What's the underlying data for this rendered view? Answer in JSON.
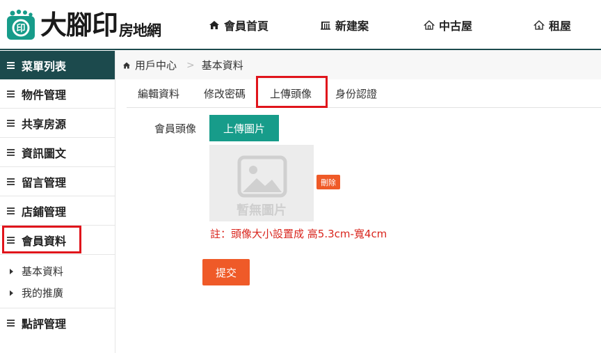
{
  "header": {
    "logo_text": "大腳印",
    "logo_sub": "房地網",
    "nav": [
      {
        "label": "會員首頁",
        "icon": "home-icon"
      },
      {
        "label": "新建案",
        "icon": "building-icon"
      },
      {
        "label": "中古屋",
        "icon": "house-icon"
      },
      {
        "label": "租屋",
        "icon": "rent-house-icon"
      }
    ]
  },
  "sidebar": {
    "title": "菜單列表",
    "items": [
      "物件管理",
      "共享房源",
      "資訊圖文",
      "留言管理",
      "店鋪管理",
      "會員資料"
    ],
    "sub_items": [
      "基本資料",
      "我的推廣"
    ],
    "last_item": "點評管理"
  },
  "breadcrumb": {
    "home": "用戶中心",
    "current": "基本資料"
  },
  "tabs": [
    "編輯資料",
    "修改密碼",
    "上傳頭像",
    "身份認證"
  ],
  "form": {
    "avatar_label": "會員頭像",
    "upload_button": "上傳圖片",
    "placeholder_text": "暫無圖片",
    "delete_button": "刪除",
    "note": "註：頭像大小設置成 高5.3cm-寬4cm",
    "submit_button": "提交"
  },
  "colors": {
    "brand_dark": "#1c4a4d",
    "upload_green": "#179c8a",
    "action_orange": "#ef5a28",
    "note_red": "#d9251d",
    "highlight_red": "#e0141b"
  }
}
